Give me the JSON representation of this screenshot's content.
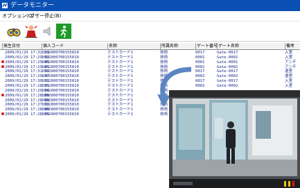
{
  "window": {
    "title": "データモニター"
  },
  "menu": [
    "オプション(O)",
    "ブザー停止(B)"
  ],
  "toolbar": [
    {
      "icon": "binoculars-icon"
    },
    {
      "icon": "alarm-person-icon"
    },
    {
      "icon": "speaker-muted-icon"
    },
    {
      "icon": "exit-runner-icon"
    }
  ],
  "table": {
    "headers": [
      "発生日付",
      "個人コード",
      "名称",
      "所属名称",
      "ゲート番号",
      "ゲート名称",
      "備考"
    ],
    "rows": [
      {
        "alert": false,
        "date": "2009/01/29 17:32:13",
        "code": "1002800700155810",
        "name": "テストカード1",
        "dept": "技術",
        "gate": "0017",
        "gate_name": "Gate-0017",
        "note": "入室"
      },
      {
        "alert": false,
        "date": "2009/01/29 17:29:52",
        "code": "1002800700155810",
        "name": "テストカード1",
        "dept": "技術",
        "gate": "0002",
        "gate_name": "Gate-0002",
        "note": "入室"
      },
      {
        "alert": true,
        "date": "2009/01/29 17:29:45",
        "code": "1002800700155810",
        "name": "テストカード1",
        "dept": "技術",
        "gate": "0001",
        "gate_name": "Gate-0001",
        "note": "アンチ"
      },
      {
        "alert": true,
        "date": "2009/01/29 17:29:41",
        "code": "1002800700155810",
        "name": "テストカード1",
        "dept": "技術",
        "gate": "0002",
        "gate_name": "Gate-0002",
        "note": "アンチ"
      },
      {
        "alert": false,
        "date": "2009/01/29 17:31:22",
        "code": "1002800700155810",
        "name": "テストカード1",
        "dept": "技術",
        "gate": "0017",
        "gate_name": "Gate-0017",
        "note": "退室"
      },
      {
        "alert": false,
        "date": "2009/01/29 17:29:37",
        "code": "1002800700155810",
        "name": "テストカード1",
        "dept": "技術",
        "gate": "0002",
        "gate_name": "Gate-0002",
        "note": "退室"
      },
      {
        "alert": false,
        "date": "2009/01/29 17:30:11",
        "code": "1002800700155810",
        "name": "テストカード1",
        "dept": "技術",
        "gate": "0017",
        "gate_name": "Gate-0017",
        "note": "入室"
      },
      {
        "alert": false,
        "date": "2009/01/29 17:28:21",
        "code": "1002800700155810",
        "name": "テストカード1",
        "dept": "技術",
        "gate": "0002",
        "gate_name": "Gate-0002",
        "note": "入室"
      },
      {
        "alert": false,
        "date": "2009/01/29 17:29:54",
        "code": "1002800700155810",
        "name": "テストカード1",
        "dept": "技術",
        "gate": "",
        "gate_name": "",
        "note": ""
      },
      {
        "alert": true,
        "date": "2009/01/29 17:28:80",
        "code": "1002800700155810",
        "name": "テストカード1",
        "dept": "技術",
        "gate": "",
        "gate_name": "",
        "note": ""
      },
      {
        "alert": false,
        "date": "2009/01/29 17:28:80",
        "code": "1002800700155810",
        "name": "テストカード1",
        "dept": "技術",
        "gate": "",
        "gate_name": "",
        "note": ""
      },
      {
        "alert": false,
        "date": "2009/01/29 17:27:22",
        "code": "1002800700155810",
        "name": "テストカード1",
        "dept": "技術",
        "gate": "",
        "gate_name": "",
        "note": ""
      },
      {
        "alert": false,
        "date": "2009/01/29 17:28:80",
        "code": "1002800700155810",
        "name": "テストカード1",
        "dept": "技術",
        "gate": "",
        "gate_name": "",
        "note": ""
      },
      {
        "alert": true,
        "date": "2009/01/29 17:28:55",
        "code": "1002800700155810",
        "name": "テストカード1",
        "dept": "技術",
        "gate": "",
        "gate_name": "",
        "note": ""
      }
    ]
  },
  "camera_view": {
    "icon": "camera-feed-photo"
  },
  "colors": {
    "titlebar": "#0a4fb4",
    "alert_dot": "#e01818",
    "row_text": "#1a2a8a",
    "arrow": "#5a86c2"
  }
}
